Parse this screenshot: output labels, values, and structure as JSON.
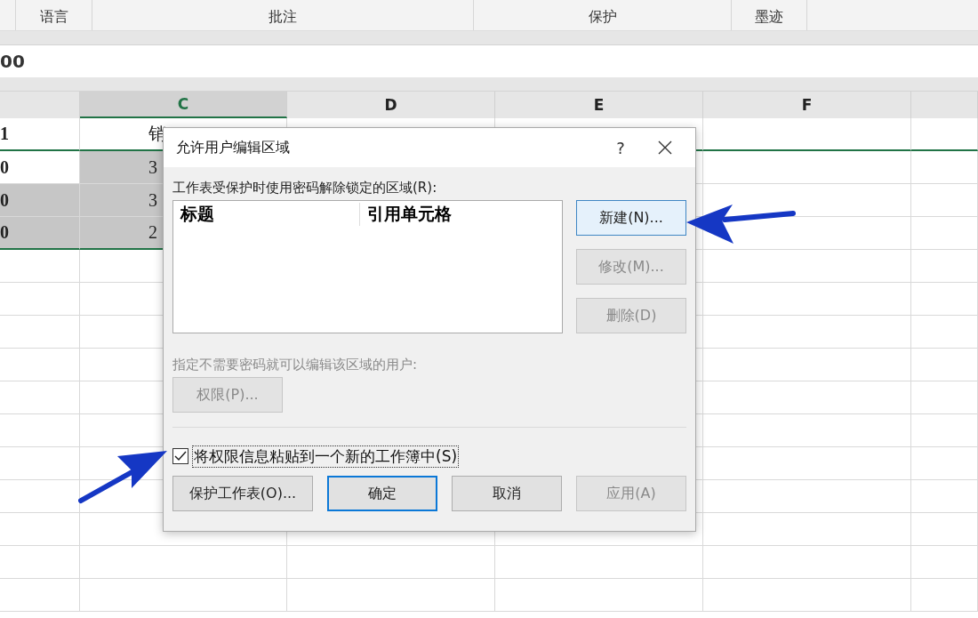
{
  "ribbon_groups": [
    {
      "label": "语言"
    },
    {
      "label": "批注"
    },
    {
      "label": "保护"
    },
    {
      "label": "墨迹"
    }
  ],
  "formula_bar": {
    "value": "00"
  },
  "columns": [
    {
      "selected": false
    },
    {
      "label": "C",
      "selected": true
    },
    {
      "label": "D",
      "selected": false
    },
    {
      "label": "E",
      "selected": false
    },
    {
      "label": "F",
      "selected": false
    }
  ],
  "rows": [
    {
      "cells": [
        {
          "text": "1",
          "selected": false
        },
        {
          "text": "销",
          "selected": false
        }
      ]
    },
    {
      "cells": [
        {
          "text": "0",
          "selected": false
        },
        {
          "text": "3",
          "selected": true
        }
      ]
    },
    {
      "cells": [
        {
          "text": "0",
          "selected": true
        },
        {
          "text": "3",
          "selected": true
        }
      ]
    },
    {
      "cells": [
        {
          "text": "0",
          "selected": true
        },
        {
          "text": "2",
          "selected": true
        }
      ]
    }
  ],
  "dialog": {
    "title": "允许用户编辑区域",
    "help": "?",
    "ranges_label": "工作表受保护时使用密码解除锁定的区域(R):",
    "ranges_columns": [
      "标题",
      "引用单元格"
    ],
    "side_buttons": [
      {
        "label": "新建(N)...",
        "disabled": false,
        "focused": true
      },
      {
        "label": "修改(M)...",
        "disabled": true,
        "focused": false
      },
      {
        "label": "删除(D)",
        "disabled": true,
        "focused": false
      }
    ],
    "users_label": "指定不需要密码就可以编辑该区域的用户:",
    "users_disabled": true,
    "permissions_button": {
      "label": "权限(P)...",
      "disabled": true
    },
    "paste_checkbox": {
      "label": "将权限信息粘贴到一个新的工作簿中(S)",
      "checked": true
    },
    "footer_buttons": [
      {
        "label": "保护工作表(O)...",
        "disabled": false,
        "default": false
      },
      {
        "label": "确定",
        "disabled": false,
        "default": true
      },
      {
        "label": "取消",
        "disabled": false,
        "default": false
      },
      {
        "label": "应用(A)",
        "disabled": true,
        "default": false
      }
    ]
  }
}
